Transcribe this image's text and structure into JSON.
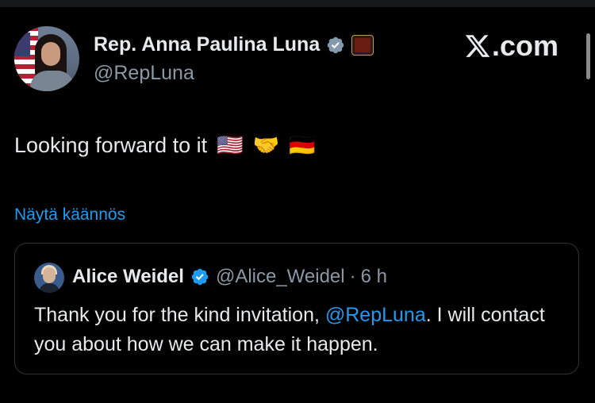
{
  "brand": {
    "domain_text": ".com"
  },
  "author": {
    "name": "Rep. Anna Paulina Luna",
    "handle": "@RepLuna"
  },
  "tweet": {
    "text": "Looking forward to it",
    "emojis": [
      "🇺🇸",
      "🤝",
      "🇩🇪"
    ]
  },
  "translate_link": "Näytä käännös",
  "quoted_tweet": {
    "name": "Alice Weidel",
    "handle": "@Alice_Weidel",
    "separator": "·",
    "time": "6 h",
    "text_before": "Thank you for the kind invitation, ",
    "mention": "@RepLuna",
    "text_after": ". I will contact you about how we can make it happen."
  },
  "colors": {
    "background": "#000000",
    "text": "#e7e9ea",
    "secondary": "#8b98a5",
    "link": "#1d9bf0",
    "border": "#2f3336"
  }
}
